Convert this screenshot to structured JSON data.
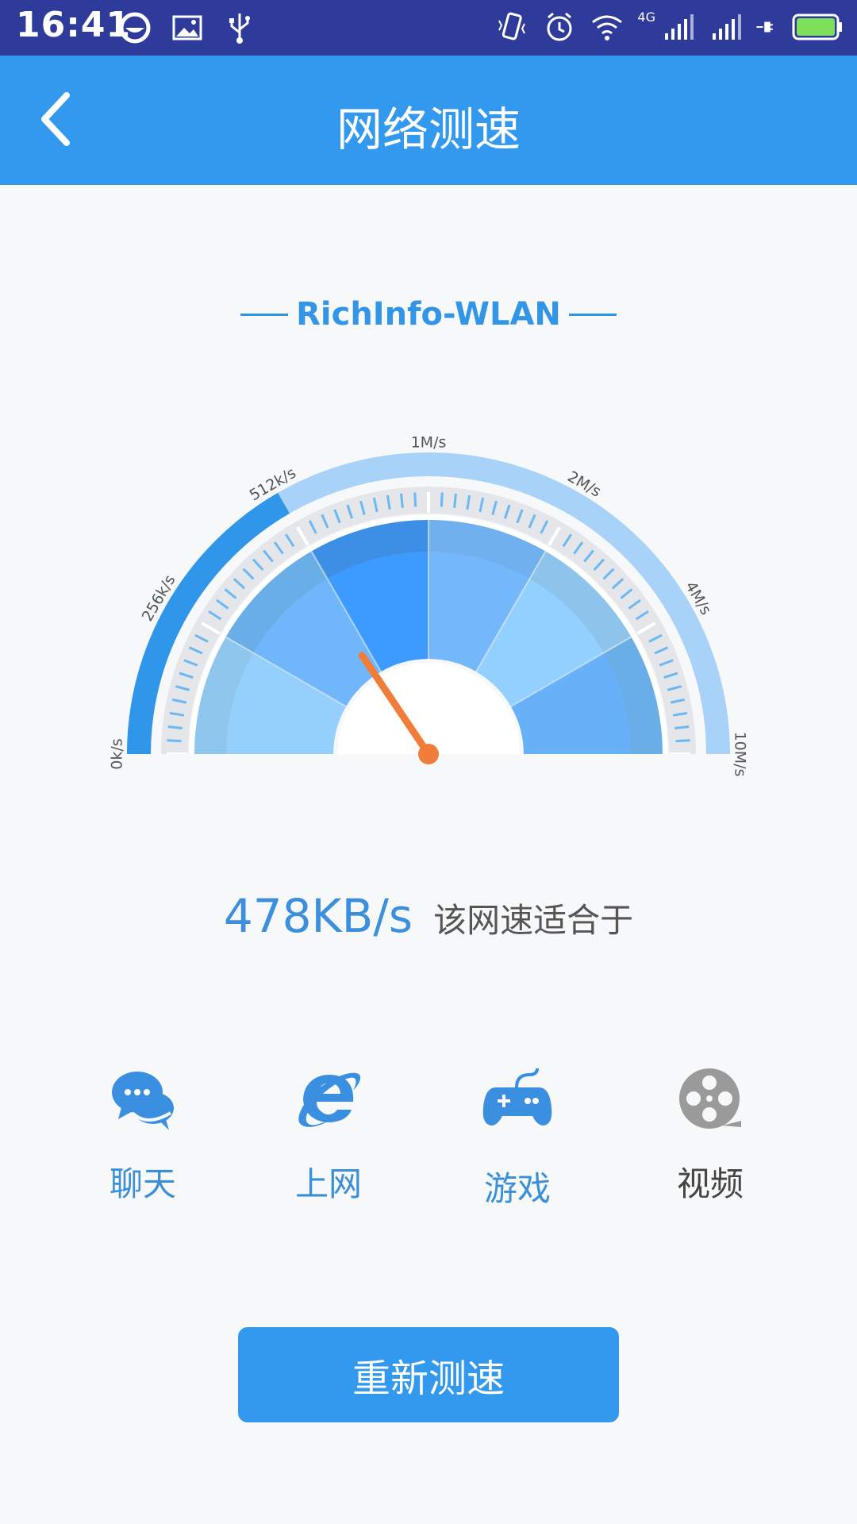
{
  "status_bar": {
    "time": "16:41",
    "network_type": "4G"
  },
  "app_bar": {
    "title": "网络测速"
  },
  "network": {
    "name": "RichInfo-WLAN"
  },
  "gauge": {
    "scale_labels": [
      "0k/s",
      "256k/s",
      "512k/s",
      "1M/s",
      "2M/s",
      "4M/s",
      "10M/s"
    ],
    "current_speed_kb": 478,
    "accent_color": "#2f96ea",
    "needle_color": "#f07d3a"
  },
  "result": {
    "speed_text": "478KB/s",
    "suitable_text": "该网速适合于"
  },
  "activities": [
    {
      "label": "聊天",
      "icon": "chat-icon",
      "suitable": true
    },
    {
      "label": "上网",
      "icon": "browser-icon",
      "suitable": true
    },
    {
      "label": "游戏",
      "icon": "gamepad-icon",
      "suitable": true
    },
    {
      "label": "视频",
      "icon": "film-reel-icon",
      "suitable": false
    }
  ],
  "actions": {
    "retest_label": "重新测速"
  },
  "colors": {
    "status_bar": "#2f3b9b",
    "app_bar": "#3399ee",
    "primary": "#3399ee"
  }
}
